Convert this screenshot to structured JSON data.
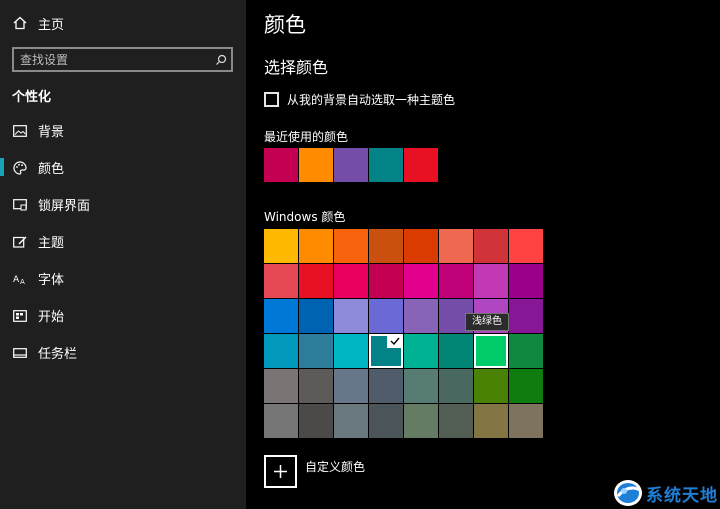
{
  "sidebar": {
    "home_label": "主页",
    "search_placeholder": "查找设置",
    "section_title": "个性化",
    "items": [
      {
        "label": "背景",
        "icon": "image-icon"
      },
      {
        "label": "颜色",
        "icon": "palette-icon",
        "active": true
      },
      {
        "label": "锁屏界面",
        "icon": "lock-screen-icon"
      },
      {
        "label": "主题",
        "icon": "theme-icon"
      },
      {
        "label": "字体",
        "icon": "font-icon"
      },
      {
        "label": "开始",
        "icon": "start-icon"
      },
      {
        "label": "任务栏",
        "icon": "taskbar-icon"
      }
    ],
    "accent_color": "#17a2b8"
  },
  "main": {
    "title": "颜色",
    "subtitle": "选择颜色",
    "auto_pick_label": "从我的背景自动选取一种主题色",
    "auto_pick_checked": false,
    "recent_label": "最近使用的颜色",
    "recent_colors": [
      "#c30052",
      "#ff8c00",
      "#744da9",
      "#038387",
      "#e81123"
    ],
    "windows_colors_label": "Windows 颜色",
    "windows_colors": [
      [
        "#ffb900",
        "#ff8c00",
        "#f7630c",
        "#ca5010",
        "#da3b01",
        "#ef6950",
        "#d13438",
        "#ff4343"
      ],
      [
        "#e74856",
        "#e81123",
        "#ea005e",
        "#c30052",
        "#e3008c",
        "#bf0077",
        "#c239b3",
        "#9a0089"
      ],
      [
        "#0078d7",
        "#0063b1",
        "#8e8cd8",
        "#6b69d6",
        "#8764b8",
        "#744da9",
        "#b146c2",
        "#881798"
      ],
      [
        "#0099bc",
        "#2d7d9a",
        "#00b7c3",
        "#038387",
        "#00b294",
        "#018574",
        "#00cc6a",
        "#10893e"
      ],
      [
        "#7a7574",
        "#5d5a58",
        "#68768a",
        "#515c6b",
        "#567c73",
        "#486860",
        "#498205",
        "#107c10"
      ],
      [
        "#767676",
        "#4c4a48",
        "#69797e",
        "#4a5459",
        "#647c64",
        "#525e54",
        "#847545",
        "#7e735f"
      ]
    ],
    "selected_color": "#038387",
    "hover_tooltip": "浅绿色",
    "custom_color_label": "自定义颜色"
  },
  "watermark": {
    "text": "系统天地"
  }
}
